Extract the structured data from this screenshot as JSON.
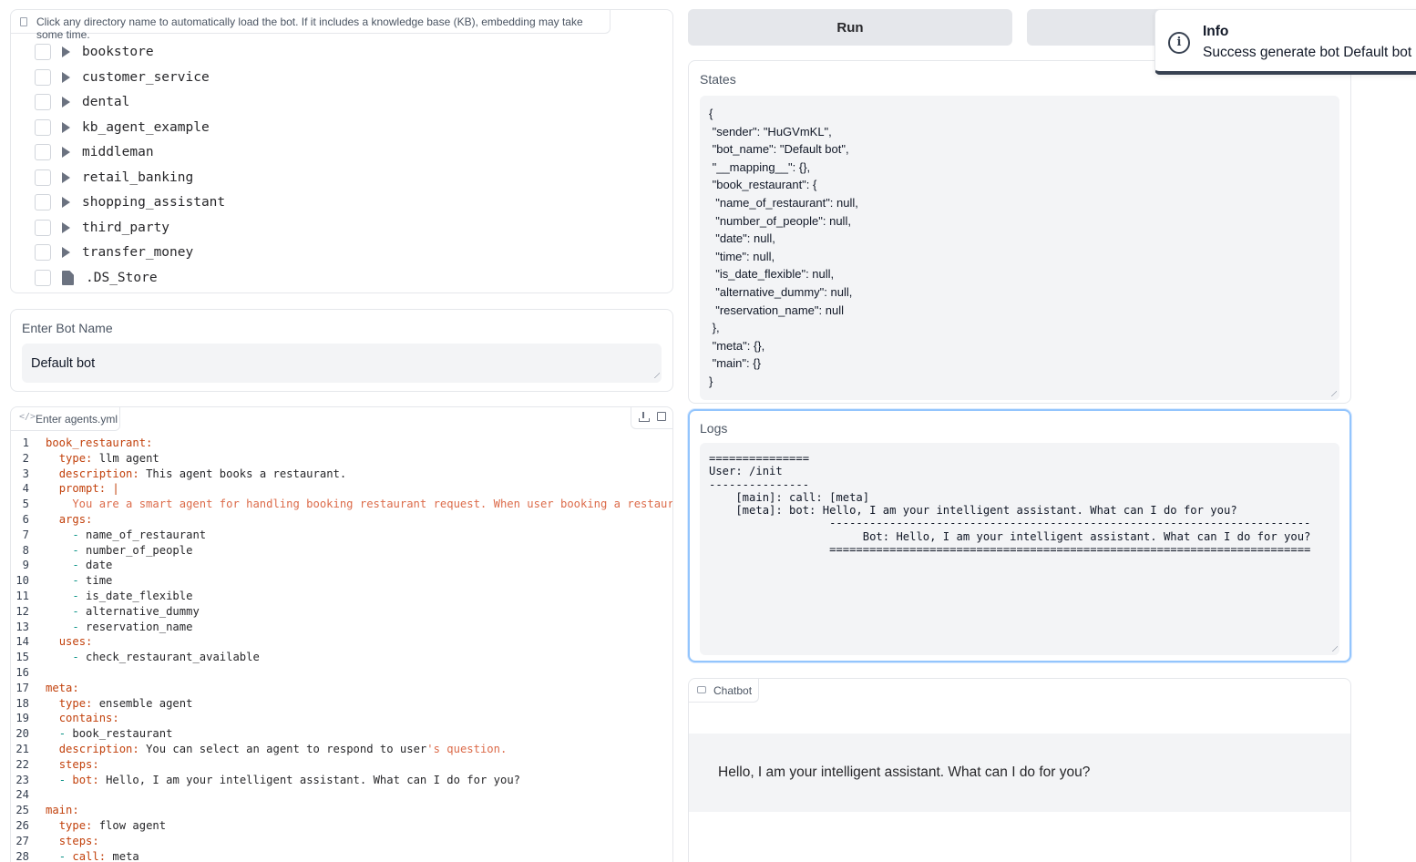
{
  "file_explorer": {
    "hint": "Click any directory name to automatically load the bot. If it includes a knowledge base (KB), embedding may take some time.",
    "items": [
      {
        "name": "bookstore",
        "type": "folder"
      },
      {
        "name": "customer_service",
        "type": "folder"
      },
      {
        "name": "dental",
        "type": "folder"
      },
      {
        "name": "kb_agent_example",
        "type": "folder"
      },
      {
        "name": "middleman",
        "type": "folder"
      },
      {
        "name": "retail_banking",
        "type": "folder"
      },
      {
        "name": "shopping_assistant",
        "type": "folder"
      },
      {
        "name": "third_party",
        "type": "folder"
      },
      {
        "name": "transfer_money",
        "type": "folder"
      },
      {
        "name": ".DS_Store",
        "type": "file"
      }
    ]
  },
  "bot_name": {
    "label": "Enter Bot Name",
    "value": "Default bot"
  },
  "code_editor": {
    "label": "Enter agents.yml",
    "lines": [
      "book_restaurant:",
      "  type: llm agent",
      "  description: This agent books a restaurant.",
      "  prompt: |",
      "    You are a smart agent for handling booking restaurant request. When user booking a restaurar",
      "  args:",
      "    - name_of_restaurant",
      "    - number_of_people",
      "    - date",
      "    - time",
      "    - is_date_flexible",
      "    - alternative_dummy",
      "    - reservation_name",
      "  uses:",
      "    - check_restaurant_available",
      "",
      "meta:",
      "  type: ensemble agent",
      "  contains:",
      "  - book_restaurant",
      "  description: You can select an agent to respond to user's question.",
      "  steps:",
      "  - bot: Hello, I am your intelligent assistant. What can I do for you?",
      "",
      "main:",
      "  type: flow agent",
      "  steps:",
      "  - call: meta"
    ]
  },
  "buttons": {
    "run_label": "Run"
  },
  "states": {
    "label": "States",
    "content": "{\n \"sender\": \"HuGVmKL\",\n \"bot_name\": \"Default bot\",\n \"__mapping__\": {},\n \"book_restaurant\": {\n  \"name_of_restaurant\": null,\n  \"number_of_people\": null,\n  \"date\": null,\n  \"time\": null,\n  \"is_date_flexible\": null,\n  \"alternative_dummy\": null,\n  \"reservation_name\": null\n },\n \"meta\": {},\n \"main\": {}\n}"
  },
  "logs": {
    "label": "Logs",
    "content": "===============\nUser: /init\n---------------\n    [main]: call: [meta]\n    [meta]: bot: Hello, I am your intelligent assistant. What can I do for you?\n                  ------------------------------------------------------------------------\n                       Bot: Hello, I am your intelligent assistant. What can I do for you?\n                  ========================================================================"
  },
  "chatbot": {
    "label": "Chatbot",
    "messages": [
      "Hello, I am your intelligent assistant. What can I do for you?"
    ]
  },
  "toast": {
    "title": "Info",
    "message": "Success generate bot Default bot"
  }
}
